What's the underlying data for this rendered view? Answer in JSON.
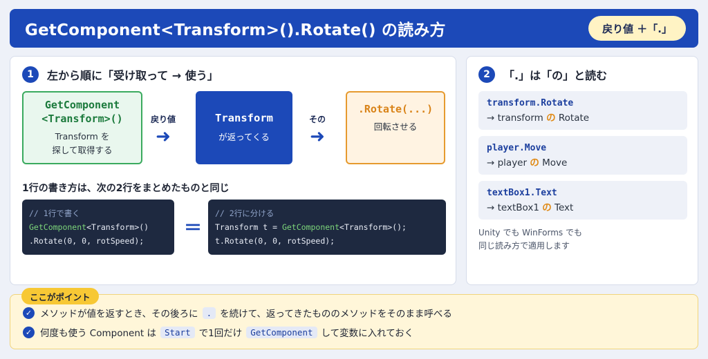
{
  "header": {
    "title": "GetComponent<Transform>().Rotate() の読み方",
    "pill": "戻り値 ＋「.」"
  },
  "step1": {
    "number": "1",
    "title": "左から順に「受け取って → 使う」",
    "box1": {
      "code_line1": "GetComponent",
      "code_line2": "<Transform>()",
      "desc_line1": "Transform を",
      "desc_line2": "探して取得する"
    },
    "arrow1_label": "戻り値",
    "box2": {
      "code": "Transform",
      "desc": "が返ってくる"
    },
    "arrow2_label": "その",
    "box3": {
      "code": ".Rotate(...)",
      "desc": "回転させる"
    },
    "subhead": "1行の書き方は、次の2行をまとめたものと同じ",
    "code_a": {
      "comment": "// 1行で書く",
      "line1_green": "GetComponent",
      "line1_rest": "<Transform>()",
      "line2": ".Rotate(0, 0, rotSpeed);"
    },
    "equals": "＝",
    "code_b": {
      "comment": "// 2行に分ける",
      "line1_pre": "Transform t = ",
      "line1_green": "GetComponent",
      "line1_rest": "<Transform>();",
      "line2": "t.Rotate(0, 0, rotSpeed);"
    }
  },
  "step2": {
    "number": "2",
    "title": "「.」は「の」と読む",
    "cards": [
      {
        "code": "transform.Rotate",
        "pre": "→ transform ",
        "no": "の",
        "post": " Rotate"
      },
      {
        "code": "player.Move",
        "pre": "→ player ",
        "no": "の",
        "post": " Move"
      },
      {
        "code": "textBox1.Text",
        "pre": "→ textBox1 ",
        "no": "の",
        "post": " Text"
      }
    ],
    "note_line1": "Unity でも WinForms でも",
    "note_line2": "同じ読み方で適用します"
  },
  "points": {
    "badge": "ここがポイント",
    "row1_pre": "メソッドが値を返すとき、その後ろに",
    "row1_chip": ".",
    "row1_post": "を続けて、返ってきたもののメソッドをそのまま呼べる",
    "row2_pre": "何度も使う Component は",
    "row2_chip1": "Start",
    "row2_mid": "で1回だけ",
    "row2_chip2": "GetComponent",
    "row2_post": "して変数に入れておく"
  },
  "icons": {
    "arrow": "right-arrow-icon",
    "check": "check-circle-icon"
  },
  "colors": {
    "primary": "#1c49b8",
    "green": "#3aaa5e",
    "orange": "#e69a2e",
    "highlight": "#f7c835"
  }
}
